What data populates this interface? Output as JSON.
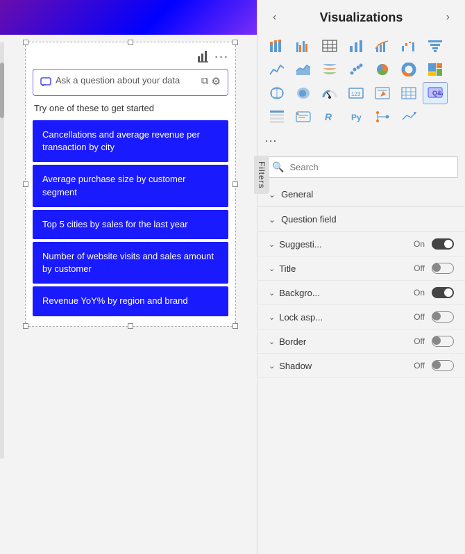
{
  "left": {
    "qa_placeholder": "Ask a question about your data",
    "try_text": "Try one of these to get started",
    "suggestions": [
      "Cancellations and average revenue per transaction by city",
      "Average purchase size by customer segment",
      "Top 5 cities by sales for the last year",
      "Number of website visits and sales amount by customer",
      "Revenue YoY% by region and brand"
    ],
    "filters_label": "Filters"
  },
  "right": {
    "title": "Visualizations",
    "search_placeholder": "Search",
    "nav_left": "‹",
    "nav_right": "›",
    "sections": [
      {
        "label": "General"
      },
      {
        "label": "Question field"
      }
    ],
    "toggles": [
      {
        "label": "Suggesti...",
        "value": "On",
        "state": "on"
      },
      {
        "label": "Title",
        "value": "Off",
        "state": "off"
      },
      {
        "label": "Backgro...",
        "value": "On",
        "state": "on"
      },
      {
        "label": "Lock asp...",
        "value": "Off",
        "state": "off"
      },
      {
        "label": "Border",
        "value": "Off",
        "state": "off"
      },
      {
        "label": "Shadow",
        "value": "Off",
        "state": "off"
      }
    ],
    "more_label": "..."
  },
  "icons": {
    "toolbar_chart": "📊",
    "toolbar_more": "•••",
    "qa_icon": "💬",
    "gear": "⚙",
    "copy": "⧉",
    "search_icon": "🔍"
  }
}
